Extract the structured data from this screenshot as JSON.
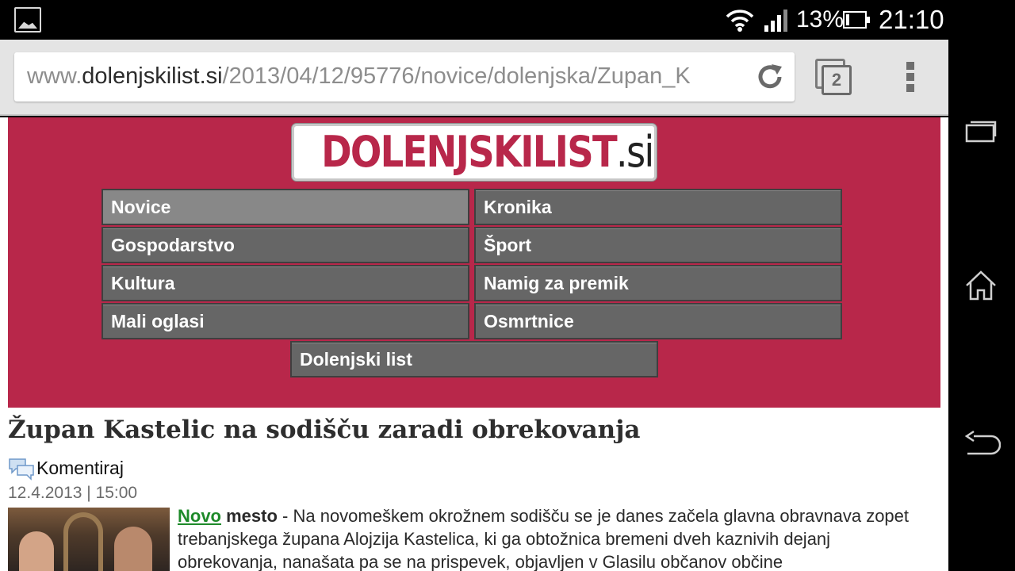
{
  "status_bar": {
    "battery_percent": "13%",
    "time": "21:10"
  },
  "browser": {
    "url_prefix": "www.",
    "url_domain": "dolenjskilist.si",
    "url_path": "/2013/04/12/95776/novice/dolenjska/Zupan_K",
    "tab_count": "2"
  },
  "site": {
    "logo_main": "DOLENJSKILIST",
    "logo_suffix": ".si",
    "nav": [
      {
        "label": "Novice",
        "active": true
      },
      {
        "label": "Kronika"
      },
      {
        "label": "Gospodarstvo"
      },
      {
        "label": "Šport"
      },
      {
        "label": "Kultura"
      },
      {
        "label": "Namig za premik"
      },
      {
        "label": "Mali oglasi"
      },
      {
        "label": "Osmrtnice"
      },
      {
        "label": "Dolenjski list"
      }
    ]
  },
  "article": {
    "headline": "Župan Kastelic na sodišču zaradi obrekovanja",
    "comment_label": "Komentiraj",
    "date": "12.4.2013 | 15:00",
    "place_part1": "Novo",
    "place_part2": "mesto",
    "body": " - Na novomeškem okrožnem sodišču se je danes začela glavna obravnava zopet trebanjskega župana Alojzija Kastelica, ki ga obtožnica bremeni dveh kaznivih dejanj obrekovanja, nanašata pa se na prispevek, objavljen v Glasilu občanov občine"
  },
  "colors": {
    "brand": "#b8274a",
    "nav_button": "#666666",
    "nav_button_active": "#888888",
    "link_green": "#1e8a2a"
  }
}
